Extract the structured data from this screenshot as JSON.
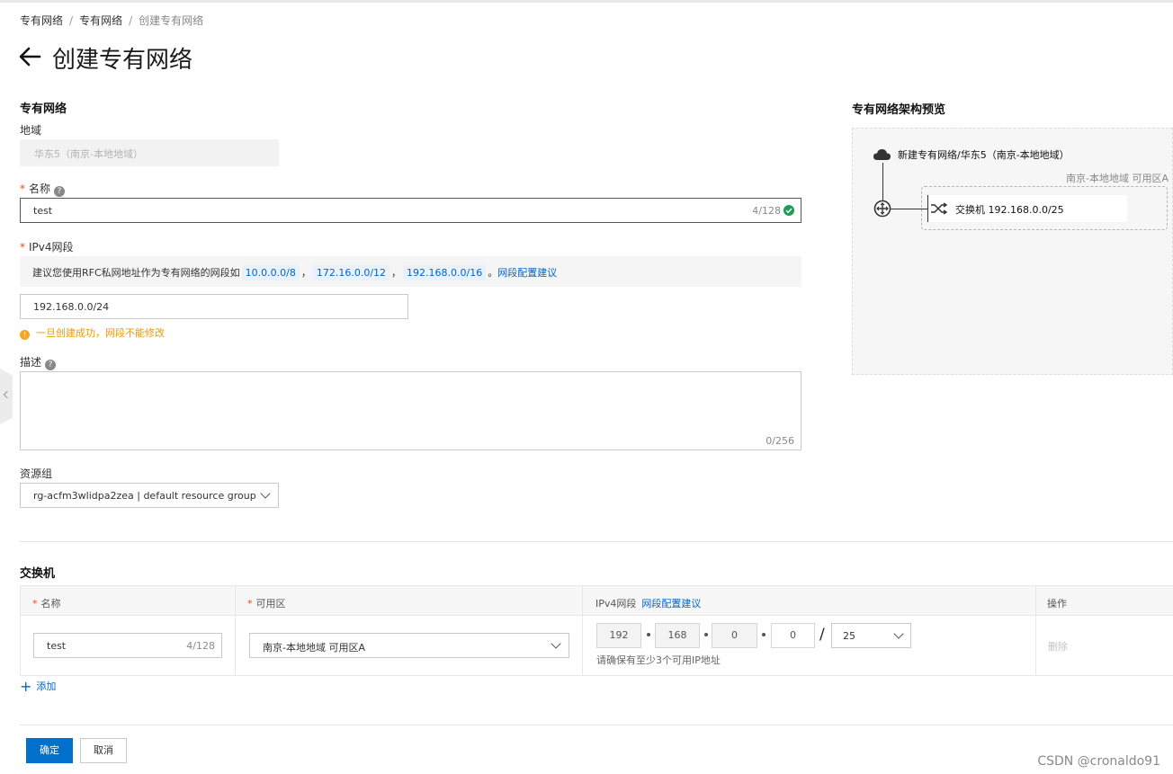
{
  "breadcrumb": {
    "items": [
      "专有网络",
      "专有网络",
      "创建专有网络"
    ],
    "separator": "/"
  },
  "page": {
    "title": "创建专有网络"
  },
  "vpc_form": {
    "section_title": "专有网络",
    "region_label": "地域",
    "region_value": "华东5（南京-本地地域）",
    "name_label": "名称",
    "name_value": "test",
    "name_counter": "4/128",
    "ipv4_label": "IPv4网段",
    "ipv4_tip_prefix": "建议您使用RFC私网地址作为专有网络的网段如",
    "ipv4_tip_tags": [
      "10.0.0.0/8",
      "172.16.0.0/12",
      "192.168.0.0/16"
    ],
    "ipv4_tip_comma": "，",
    "ipv4_tip_period": "。",
    "ipv4_tip_link": "网段配置建议",
    "ipv4_value": "192.168.0.0/24",
    "ipv4_warning": "一旦创建成功，网段不能修改",
    "desc_label": "描述",
    "desc_value": "",
    "desc_counter": "0/256",
    "resource_group_label": "资源组",
    "resource_group_value": "rg-acfm3wlidpa2zea | default resource group"
  },
  "preview": {
    "title": "专有网络架构预览",
    "vpc_label": "新建专有网络/华东5（南京-本地地域）",
    "zone_label": "南京-本地地域 可用区A",
    "switch_label": "交换机 192.168.0.0/25"
  },
  "vswitch": {
    "section_title": "交换机",
    "headers": {
      "name": "名称",
      "zone": "可用区",
      "ipv4": "IPv4网段",
      "ipv4_link": "网段配置建议",
      "action": "操作"
    },
    "row": {
      "name": "test",
      "name_counter": "4/128",
      "zone": "南京-本地地域 可用区A",
      "ip_octets": [
        "192",
        "168",
        "0",
        "0"
      ],
      "mask_separator": "/",
      "mask": "25",
      "ip_hint": "请确保有至少3个可用IP地址",
      "delete": "删除"
    },
    "add_label": "添加"
  },
  "footer": {
    "confirm": "确定",
    "cancel": "取消"
  },
  "watermark": "CSDN @cronaldo91",
  "colors": {
    "primary": "#0070cc",
    "link": "#0064c8",
    "warning": "#f5a623",
    "success": "#1e9c57",
    "required": "#e64a19"
  }
}
